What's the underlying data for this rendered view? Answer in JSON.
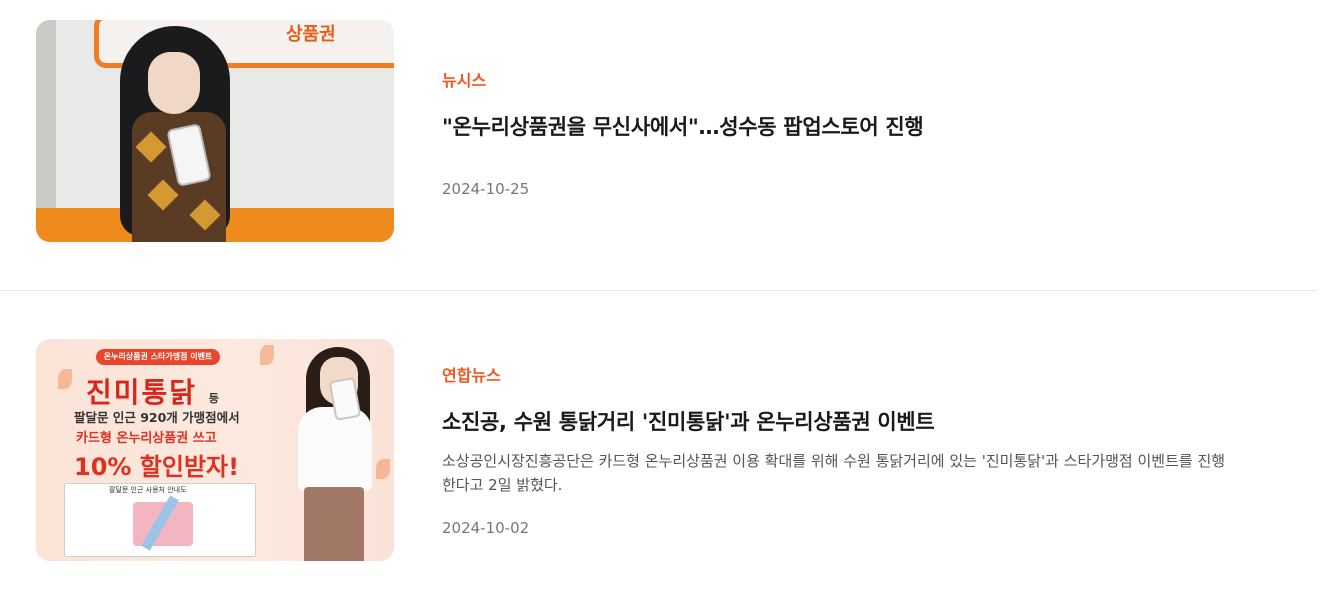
{
  "articles": [
    {
      "source": "뉴시스",
      "title": "\"온누리상품권을 무신사에서\"…성수동 팝업스토어 진행",
      "summary": "",
      "date": "2024-10-25",
      "thumbnail": {
        "banner_text": "상품권"
      }
    },
    {
      "source": "연합뉴스",
      "title": "소진공, 수원 통닭거리 '진미통닭'과 온누리상품권 이벤트",
      "summary": "소상공인시장진흥공단은 카드형 온누리상품권 이용 확대를 위해 수원 통닭거리에 있는 '진미통닭'과 스타가맹점 이벤트를 진행한다고 2일 밝혔다.",
      "date": "2024-10-02",
      "thumbnail": {
        "pill": "온누리상품권 스타가맹점 이벤트",
        "headline": "진미통닭",
        "headline_suffix": "등",
        "line1": "팔달문 인근 920개 가맹점에서",
        "line2": "카드형 온누리상품권 쓰고",
        "line3": "10% 할인받자!",
        "map_title": "팔달문 인근 사용처 안내도"
      }
    }
  ],
  "colors": {
    "source": "#f0591f",
    "accent_orange": "#ef8a1c"
  }
}
